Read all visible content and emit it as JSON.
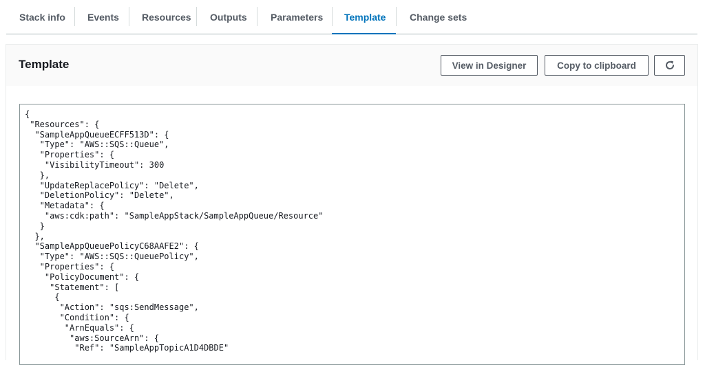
{
  "tabs": [
    {
      "label": "Stack info"
    },
    {
      "label": "Events"
    },
    {
      "label": "Resources"
    },
    {
      "label": "Outputs"
    },
    {
      "label": "Parameters"
    },
    {
      "label": "Template",
      "active": true
    },
    {
      "label": "Change sets"
    }
  ],
  "panel": {
    "title": "Template",
    "view_designer_label": "View in Designer",
    "copy_label": "Copy to clipboard",
    "refresh_icon": "refresh-icon"
  },
  "template_lines": [
    "{",
    " \"Resources\": {",
    "  \"SampleAppQueueECFF513D\": {",
    "   \"Type\": \"AWS::SQS::Queue\",",
    "   \"Properties\": {",
    "    \"VisibilityTimeout\": 300",
    "   },",
    "   \"UpdateReplacePolicy\": \"Delete\",",
    "   \"DeletionPolicy\": \"Delete\",",
    "   \"Metadata\": {",
    "    \"aws:cdk:path\": \"SampleAppStack/SampleAppQueue/Resource\"",
    "   }",
    "  },",
    "  \"SampleAppQueuePolicyC68AAFE2\": {",
    "   \"Type\": \"AWS::SQS::QueuePolicy\",",
    "   \"Properties\": {",
    "    \"PolicyDocument\": {",
    "     \"Statement\": [",
    "      {",
    "       \"Action\": \"sqs:SendMessage\",",
    "       \"Condition\": {",
    "        \"ArnEquals\": {",
    "         \"aws:SourceArn\": {",
    "          \"Ref\": \"SampleAppTopicA1D4DBDE\""
  ],
  "colors": {
    "accent": "#0073bb",
    "tab_text": "#545b64",
    "title_text": "#16191f"
  }
}
